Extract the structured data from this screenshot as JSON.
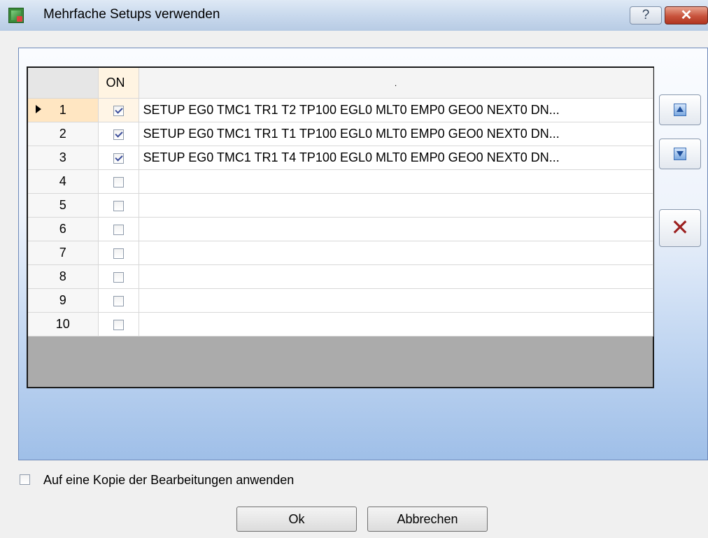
{
  "window": {
    "title": "Mehrfache Setups verwenden",
    "help_label": "?",
    "close_label": "✕"
  },
  "grid": {
    "columns": {
      "on": "ON",
      "description": "."
    },
    "rows": [
      {
        "num": "1",
        "on": true,
        "text": "SETUP EG0 TMC1 TR1 T2 TP100 EGL0 MLT0 EMP0 GEO0 NEXT0 DN...",
        "selected": true
      },
      {
        "num": "2",
        "on": true,
        "text": "SETUP EG0 TMC1 TR1 T1 TP100 EGL0 MLT0 EMP0 GEO0 NEXT0 DN..."
      },
      {
        "num": "3",
        "on": true,
        "text": "SETUP EG0 TMC1 TR1 T4 TP100 EGL0 MLT0 EMP0 GEO0 NEXT0 DN..."
      },
      {
        "num": "4",
        "on": false,
        "text": ""
      },
      {
        "num": "5",
        "on": false,
        "text": ""
      },
      {
        "num": "6",
        "on": false,
        "text": ""
      },
      {
        "num": "7",
        "on": false,
        "text": ""
      },
      {
        "num": "8",
        "on": false,
        "text": ""
      },
      {
        "num": "9",
        "on": false,
        "text": ""
      },
      {
        "num": "10",
        "on": false,
        "text": ""
      }
    ]
  },
  "side_buttons": {
    "move_up": "arrow-up-icon",
    "move_down": "arrow-down-icon",
    "delete": "delete-x-icon"
  },
  "footer": {
    "apply_copy_label": "Auf eine Kopie der Bearbeitungen anwenden",
    "apply_copy_checked": false,
    "ok_label": "Ok",
    "cancel_label": "Abbrechen"
  }
}
